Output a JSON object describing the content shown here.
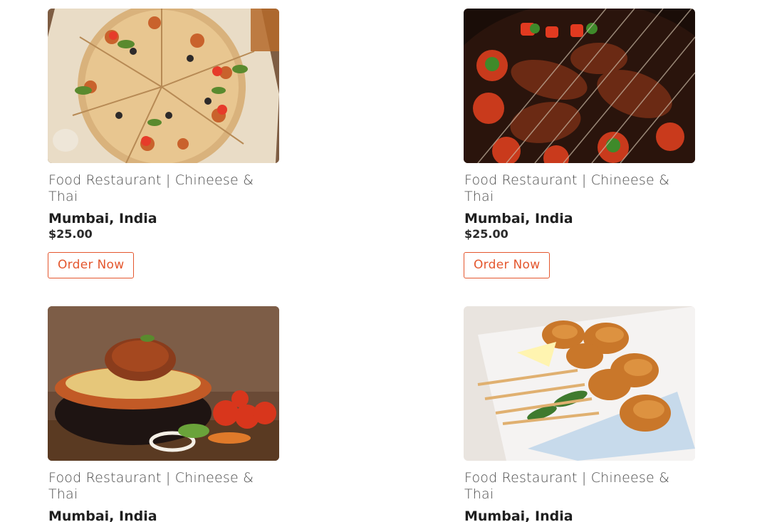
{
  "items": [
    {
      "photo_icon": "pizza-photo",
      "category": "Food Restaurant | Chineese & Thai",
      "location": "Mumbai, India",
      "price": "$25.00",
      "button_label": "Order Now"
    },
    {
      "photo_icon": "grill-photo",
      "category": "Food Restaurant | Chineese & Thai",
      "location": "Mumbai, India",
      "price": "$25.00",
      "button_label": "Order Now"
    },
    {
      "photo_icon": "pasta-photo",
      "category": "Food Restaurant | Chineese & Thai",
      "location": "Mumbai, India",
      "price": "",
      "button_label": ""
    },
    {
      "photo_icon": "fried-food-photo",
      "category": "Food Restaurant | Chineese & Thai",
      "location": "Mumbai, India",
      "price": "",
      "button_label": ""
    }
  ],
  "colors": {
    "accent": "#e4572e",
    "text_dark": "#1f1f1f",
    "text_muted": "#4a4a4a"
  }
}
